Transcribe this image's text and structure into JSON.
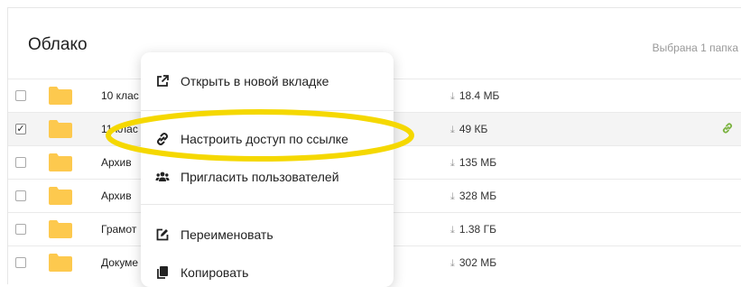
{
  "header": {
    "title": "Облако",
    "selection_info": "Выбрана 1 папка"
  },
  "files": [
    {
      "name": "10 клас",
      "size": "18.4 МБ",
      "checked": false,
      "selected": false,
      "shared": false
    },
    {
      "name": "11 клас",
      "size": "49 КБ",
      "checked": true,
      "selected": true,
      "shared": true
    },
    {
      "name": "Архив",
      "size": "135 МБ",
      "checked": false,
      "selected": false,
      "shared": false
    },
    {
      "name": "Архив",
      "size": "328 МБ",
      "checked": false,
      "selected": false,
      "shared": false
    },
    {
      "name": "Грамот",
      "size": "1.38 ГБ",
      "checked": false,
      "selected": false,
      "shared": false
    },
    {
      "name": "Докуме",
      "size": "302 МБ",
      "checked": false,
      "selected": false,
      "shared": false
    }
  ],
  "context_menu": {
    "open_new_tab": "Открыть в новой вкладке",
    "share_link": "Настроить доступ по ссылке",
    "invite_users": "Пригласить пользователей",
    "rename": "Переименовать",
    "copy": "Копировать"
  },
  "colors": {
    "folder": "#fdc94e",
    "link_icon": "#7cb342",
    "highlight": "#f5d800"
  }
}
